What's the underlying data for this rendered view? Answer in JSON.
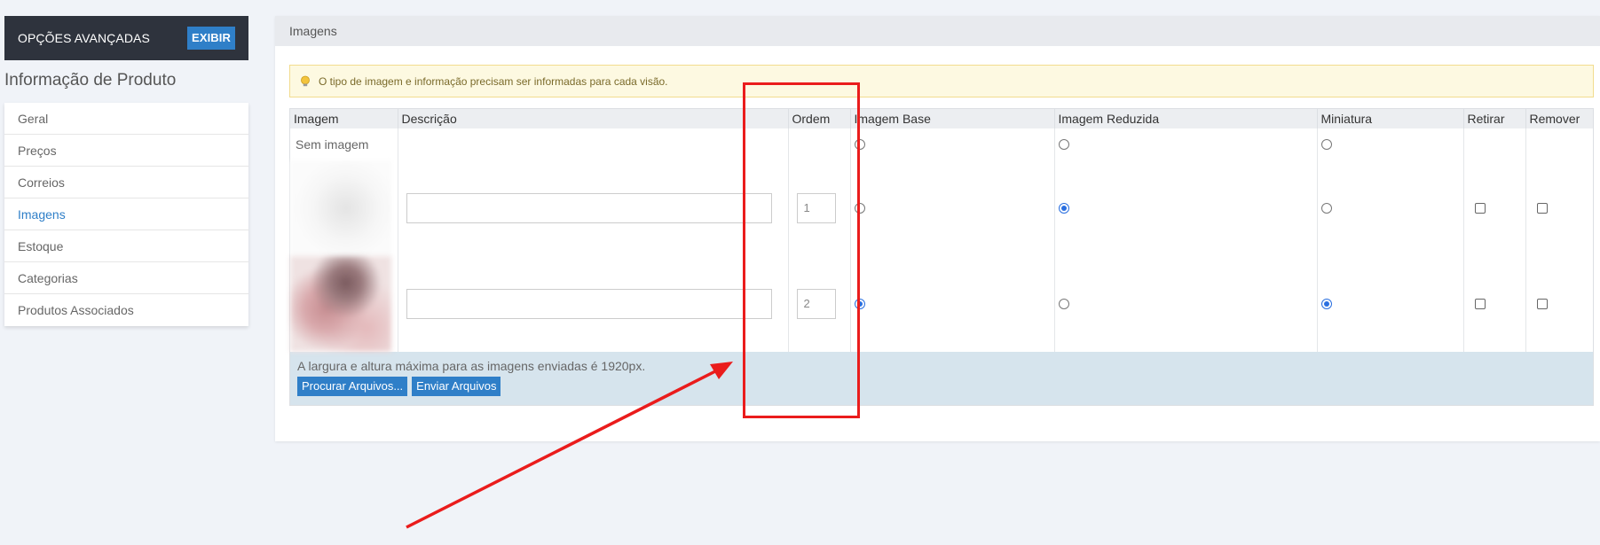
{
  "sidebar": {
    "advanced_label": "OPÇÕES AVANÇADAS",
    "advanced_button": "EXIBIR",
    "title": "Informação de Produto",
    "items": [
      {
        "label": "Geral"
      },
      {
        "label": "Preços"
      },
      {
        "label": "Correios"
      },
      {
        "label": "Imagens"
      },
      {
        "label": "Estoque"
      },
      {
        "label": "Categorias"
      },
      {
        "label": "Produtos Associados"
      }
    ],
    "active_item": "Imagens"
  },
  "panel": {
    "title": "Imagens",
    "notice": "O tipo de imagem e informação precisam ser informadas para cada visão.",
    "columns": [
      "Imagem",
      "Descrição",
      "Ordem",
      "Imagem Base",
      "Imagem Reduzida",
      "Miniatura",
      "Retirar",
      "Remover"
    ],
    "no_image_label": "Sem imagem",
    "rows": [
      {
        "description": "",
        "order": "1",
        "base": false,
        "reduced": true,
        "thumbnail": false,
        "exclude": false,
        "remove": false
      },
      {
        "description": "",
        "order": "2",
        "base": true,
        "reduced": false,
        "thumbnail": true,
        "exclude": false,
        "remove": false
      }
    ],
    "footer_text": "A largura e altura máxima para as imagens enviadas é 1920px.",
    "browse_button": "Procurar Arquivos...",
    "upload_button": "Enviar Arquivos"
  },
  "colors": {
    "accent": "#2f7fc8",
    "annotation": "#ea1c1c"
  }
}
